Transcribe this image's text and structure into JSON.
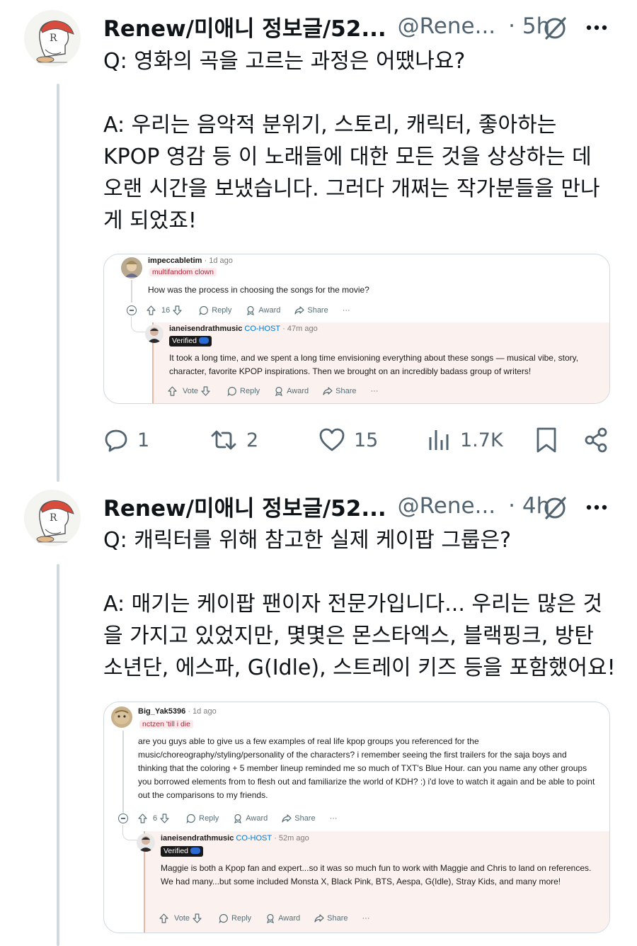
{
  "tweets": [
    {
      "author": {
        "name": "Renew/미애니 정보글/52...",
        "handle": "@Rene...",
        "time": "· 5h"
      },
      "text": "Q: 영화의 곡을 고르는 과정은 어땠나요?\n\nA: 우리는 음악적 분위기, 스토리, 캐릭터, 좋아하는\nKPOP 영감 등 이 노래들에 대한 모든 것을 상상하는 데\n오랜 시간을 보냈습니다. 그러다 개쩌는 작가분들을 만나\n게 되었죠!",
      "embed": {
        "question": {
          "user": "impeccabletim",
          "age": "· 1d ago",
          "flair": "multifandom clown",
          "text": "How was the process in choosing the songs for the movie?",
          "votes": "16",
          "reply": "Reply",
          "award": "Award",
          "share": "Share",
          "more": "···"
        },
        "answer": {
          "user": "ianeisendrathmusic",
          "role": "CO-HOST",
          "age": "· 47m ago",
          "verified": "Verified",
          "text": "It took a long time, and we spent a long time envisioning everything about these songs — musical vibe, story, character, favorite KPOP inspirations. Then we brought on an incredibly badass group of writers!",
          "vote": "Vote",
          "reply": "Reply",
          "award": "Award",
          "share": "Share",
          "more": "···"
        }
      },
      "stats": {
        "replies": "1",
        "reposts": "2",
        "likes": "15",
        "views": "1.7K"
      }
    },
    {
      "author": {
        "name": "Renew/미애니 정보글/52...",
        "handle": "@Rene...",
        "time": "· 4h"
      },
      "text": "Q: 캐릭터를 위해 참고한 실제 케이팝 그룹은?\n\nA: 매기는 케이팝 팬이자 전문가입니다... 우리는 많은 것\n을 가지고 있었지만, 몇몇은 몬스타엑스, 블랙핑크, 방탄\n소년단, 에스파, G(Idle), 스트레이 키즈 등을 포함했어요!",
      "embed": {
        "question": {
          "user": "Big_Yak5396",
          "age": "· 1d ago",
          "flair": "nctzen 'till i die",
          "text": "are you guys able to give us a few examples of real life kpop groups you referenced for the music/choreography/styling/personality of the characters? i remember seeing the first trailers for the saja boys and thinking that the coloring + 5 member lineup reminded me so much of TXT's Blue Hour. can you name any other groups you borrowed elements from to flesh out and familiarize the world of KDH? :) i'd love to watch it again and be able to point out the comparisons to my friends.",
          "votes": "6",
          "reply": "Reply",
          "award": "Award",
          "share": "Share",
          "more": "···"
        },
        "answer": {
          "user": "ianeisendrathmusic",
          "role": "CO-HOST",
          "age": "· 52m ago",
          "verified": "Verified",
          "text": "Maggie is both a Kpop fan and expert...so it was so much fun to work with Maggie and Chris to land on references. We had many...but some included Monsta X, Black Pink, BTS, Aespa, G(Idle), Stray Kids, and many more!",
          "vote": "Vote",
          "reply": "Reply",
          "award": "Award",
          "share": "Share",
          "more": "···"
        }
      }
    }
  ],
  "colors": {
    "text": "#0f1419",
    "secondary": "#536471",
    "thread": "#cfd9de",
    "reddit_link": "#0079d3",
    "reply_bg": "#fbf1ee"
  },
  "icons": [
    "grok-slash-icon",
    "more-icon",
    "reply-icon",
    "repost-icon",
    "like-icon",
    "views-icon",
    "bookmark-icon",
    "share-icon",
    "upvote-icon",
    "downvote-icon",
    "comment-icon",
    "award-icon",
    "reddit-share-icon"
  ]
}
